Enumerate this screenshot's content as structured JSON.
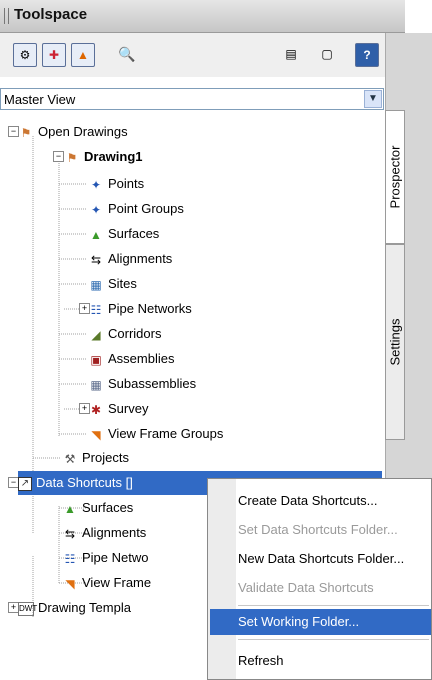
{
  "palette": {
    "title": "Toolspace"
  },
  "toolbar": {
    "icons": [
      "prospector-icon",
      "settings-icon",
      "survey-icon",
      "search-icon",
      "panel-icon",
      "panel-icon-2",
      "help-icon"
    ]
  },
  "view": {
    "selected": "Master View"
  },
  "tabs": [
    "Prospector",
    "Settings"
  ],
  "tree": {
    "open_drawings": "Open Drawings",
    "drawing1": "Drawing1",
    "points": "Points",
    "point_groups": "Point Groups",
    "surfaces": "Surfaces",
    "alignments": "Alignments",
    "sites": "Sites",
    "pipe_networks": "Pipe Networks",
    "corridors": "Corridors",
    "assemblies": "Assemblies",
    "subassemblies": "Subassemblies",
    "survey": "Survey",
    "view_frame_groups": "View Frame Groups",
    "projects": "Projects",
    "data_shortcuts": "Data Shortcuts []",
    "ds_surfaces": "Surfaces",
    "ds_alignments": "Alignments",
    "ds_pipe_networks": "Pipe Netwo",
    "ds_view_frame": "View Frame",
    "drawing_templates": "Drawing Templa"
  },
  "context_menu": {
    "items": [
      "Create Data Shortcuts...",
      "Set Data Shortcuts Folder...",
      "New Data Shortcuts Folder...",
      "Validate Data Shortcuts",
      "Set Working Folder...",
      "Refresh"
    ],
    "disabled": [
      1,
      3
    ],
    "highlighted": 4
  }
}
